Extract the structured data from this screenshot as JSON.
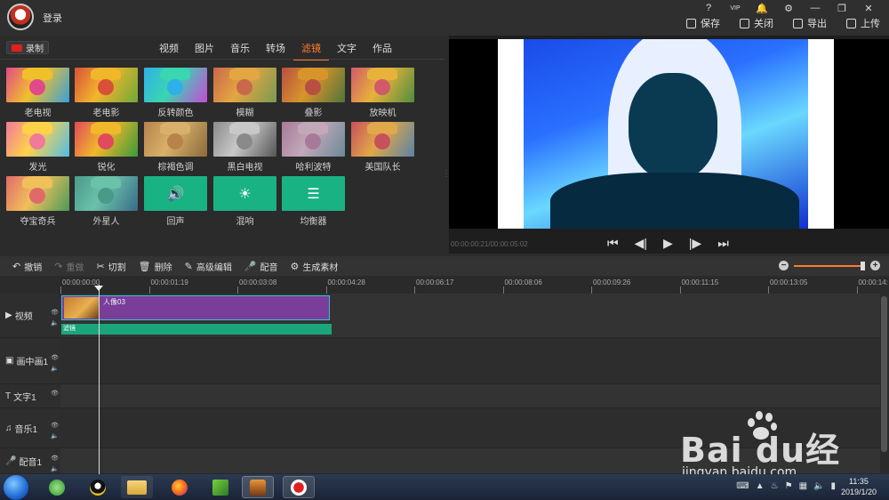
{
  "app": {
    "login_label": "登录",
    "window_controls": [
      "?",
      "VIP",
      "🔔",
      "⚙",
      "—",
      "❐",
      "✕"
    ]
  },
  "top_actions": [
    {
      "label": "保存",
      "icon": "save-icon"
    },
    {
      "label": "关闭",
      "icon": "close-doc-icon"
    },
    {
      "label": "导出",
      "icon": "export-icon"
    },
    {
      "label": "上传",
      "icon": "upload-icon"
    }
  ],
  "media": {
    "record_label": "录制",
    "tabs": [
      "视频",
      "图片",
      "音乐",
      "转场",
      "滤镜",
      "文字",
      "作品"
    ],
    "active_tab": "滤镜",
    "filters": [
      {
        "label": "老电视",
        "kind": "color",
        "colors": [
          "#e04a8a",
          "#f0c02a",
          "#3aa0d8"
        ]
      },
      {
        "label": "老电影",
        "kind": "color",
        "colors": [
          "#d9503a",
          "#f2b62a",
          "#6fa83a"
        ]
      },
      {
        "label": "反转颜色",
        "kind": "color",
        "colors": [
          "#2fb0e8",
          "#39d6b0",
          "#c74ad8"
        ]
      },
      {
        "label": "模糊",
        "kind": "color",
        "colors": [
          "#c9684a",
          "#e3a642",
          "#7a9a52"
        ]
      },
      {
        "label": "叠影",
        "kind": "color",
        "colors": [
          "#b85042",
          "#d8942a",
          "#53743a"
        ]
      },
      {
        "label": "放映机",
        "kind": "color",
        "colors": [
          "#d05a6a",
          "#e8b23a",
          "#4e8d3e"
        ]
      },
      {
        "label": "发光",
        "kind": "color",
        "colors": [
          "#f07a9a",
          "#ffd24a",
          "#4fbde8"
        ]
      },
      {
        "label": "锐化",
        "kind": "color",
        "colors": [
          "#e04a5a",
          "#f0b82a",
          "#3a9a3a"
        ]
      },
      {
        "label": "棕褐色调",
        "kind": "color",
        "colors": [
          "#b8834a",
          "#d8b06a",
          "#8a6a3a"
        ]
      },
      {
        "label": "黑白电视",
        "kind": "color",
        "colors": [
          "#8a8a8a",
          "#c8c8c8",
          "#555555"
        ]
      },
      {
        "label": "哈利波特",
        "kind": "color",
        "colors": [
          "#a87a9a",
          "#c2a8b8",
          "#6a8a9a"
        ]
      },
      {
        "label": "美国队长",
        "kind": "color",
        "colors": [
          "#c8505a",
          "#e0a84a",
          "#5a82a8"
        ]
      },
      {
        "label": "夺宝奇兵",
        "kind": "color",
        "colors": [
          "#e06a6a",
          "#f0c05a",
          "#4a9a5a"
        ]
      },
      {
        "label": "外星人",
        "kind": "color",
        "colors": [
          "#4a9a8a",
          "#6ac2a8",
          "#3a6a8a"
        ]
      },
      {
        "label": "回声",
        "kind": "audio",
        "glyph": "🔊"
      },
      {
        "label": "混响",
        "kind": "audio",
        "glyph": "☀"
      },
      {
        "label": "均衡器",
        "kind": "audio",
        "glyph": "☰"
      }
    ]
  },
  "preview": {
    "timecode": "00:00:00:21/00:00:05:02",
    "transport": [
      "⏮",
      "◀|",
      "▶",
      "|▶",
      "⏭"
    ]
  },
  "toolbar": {
    "items": [
      {
        "label": "撤销",
        "icon": "↶",
        "name": "undo",
        "enabled": true
      },
      {
        "label": "重做",
        "icon": "↷",
        "name": "redo",
        "enabled": false
      },
      {
        "label": "切割",
        "icon": "✂",
        "name": "cut",
        "enabled": true
      },
      {
        "label": "删除",
        "icon": "🗑",
        "name": "delete",
        "enabled": true
      },
      {
        "label": "高级编辑",
        "icon": "✎",
        "name": "advanced-edit",
        "enabled": true
      },
      {
        "label": "配音",
        "icon": "🎤",
        "name": "dub",
        "enabled": true
      },
      {
        "label": "生成素材",
        "icon": "⚙",
        "name": "generate-material",
        "enabled": true
      }
    ]
  },
  "timeline": {
    "ruler": [
      "00:00:00:00",
      "00:00:01:19",
      "00:00:03:08",
      "00:00:04:28",
      "00:00:06:17",
      "00:00:08:06",
      "00:00:09:26",
      "00:00:11:15",
      "00:00:13:05",
      "00:00:14:"
    ],
    "tracks": [
      {
        "label": "视频",
        "icon": "▶",
        "name": "video"
      },
      {
        "label": "画中画1",
        "icon": "▣",
        "name": "pip1"
      },
      {
        "label": "文字1",
        "icon": "T",
        "name": "text1"
      },
      {
        "label": "音乐1",
        "icon": "♫",
        "name": "music1"
      },
      {
        "label": "配音1",
        "icon": "🎤",
        "name": "voice1"
      }
    ],
    "clip_label": "人像03",
    "filter_label": "滤镜"
  },
  "watermark": {
    "brand": "Bai  du经验",
    "url": "jingyan.baidu.com"
  },
  "taskbar": {
    "time": "11:35",
    "date": "2019/1/20"
  }
}
